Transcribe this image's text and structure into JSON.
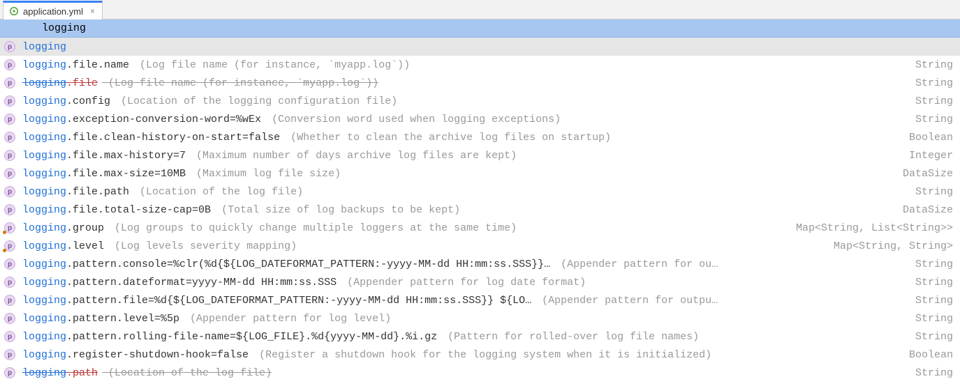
{
  "tab": {
    "label": "application.yml"
  },
  "editor": {
    "typed": "logging"
  },
  "badge_letter": "p",
  "suggestions": [
    {
      "selected": true,
      "prefix": "logging",
      "key": "",
      "desc": "",
      "type": "",
      "deprecated": false,
      "dotted": false
    },
    {
      "prefix": "logging",
      "key": ".file.name",
      "desc": " (Log file name (for instance, `myapp.log`))",
      "type": "String",
      "deprecated": false,
      "dotted": false
    },
    {
      "prefix": "logging",
      "key": ".file",
      "desc": " (Log file name (for instance, `myapp.log`))",
      "type": "String",
      "deprecated": true,
      "dotted": false
    },
    {
      "prefix": "logging",
      "key": ".config",
      "desc": " (Location of the logging configuration file)",
      "type": "String",
      "deprecated": false,
      "dotted": false
    },
    {
      "prefix": "logging",
      "key": ".exception-conversion-word=%wEx",
      "desc": " (Conversion word used when logging exceptions)",
      "type": "String",
      "deprecated": false,
      "dotted": false
    },
    {
      "prefix": "logging",
      "key": ".file.clean-history-on-start=false",
      "desc": " (Whether to clean the archive log files on startup)",
      "type": "Boolean",
      "deprecated": false,
      "dotted": false
    },
    {
      "prefix": "logging",
      "key": ".file.max-history=7",
      "desc": " (Maximum number of days archive log files are kept)",
      "type": "Integer",
      "deprecated": false,
      "dotted": false
    },
    {
      "prefix": "logging",
      "key": ".file.max-size=10MB",
      "desc": " (Maximum log file size)",
      "type": "DataSize",
      "deprecated": false,
      "dotted": false
    },
    {
      "prefix": "logging",
      "key": ".file.path",
      "desc": " (Location of the log file)",
      "type": "String",
      "deprecated": false,
      "dotted": false
    },
    {
      "prefix": "logging",
      "key": ".file.total-size-cap=0B",
      "desc": " (Total size of log backups to be kept)",
      "type": "DataSize",
      "deprecated": false,
      "dotted": false
    },
    {
      "prefix": "logging",
      "key": ".group",
      "desc": " (Log groups to quickly change multiple loggers at the same time)",
      "type": "Map<String, List<String>>",
      "deprecated": false,
      "dotted": true
    },
    {
      "prefix": "logging",
      "key": ".level",
      "desc": " (Log levels severity mapping)",
      "type": "Map<String, String>",
      "deprecated": false,
      "dotted": true
    },
    {
      "prefix": "logging",
      "key": ".pattern.console=%clr(%d{${LOG_DATEFORMAT_PATTERN:-yyyy-MM-dd HH:mm:ss.SSS}}…",
      "desc": " (Appender pattern for ou…",
      "type": "String",
      "deprecated": false,
      "dotted": false
    },
    {
      "prefix": "logging",
      "key": ".pattern.dateformat=yyyy-MM-dd HH:mm:ss.SSS",
      "desc": " (Appender pattern for log date format)",
      "type": "String",
      "deprecated": false,
      "dotted": false
    },
    {
      "prefix": "logging",
      "key": ".pattern.file=%d{${LOG_DATEFORMAT_PATTERN:-yyyy-MM-dd HH:mm:ss.SSS}} ${LO…",
      "desc": " (Appender pattern for outpu…",
      "type": "String",
      "deprecated": false,
      "dotted": false
    },
    {
      "prefix": "logging",
      "key": ".pattern.level=%5p",
      "desc": " (Appender pattern for log level)",
      "type": "String",
      "deprecated": false,
      "dotted": false
    },
    {
      "prefix": "logging",
      "key": ".pattern.rolling-file-name=${LOG_FILE}.%d{yyyy-MM-dd}.%i.gz",
      "desc": " (Pattern for rolled-over log file names)",
      "type": "String",
      "deprecated": false,
      "dotted": false
    },
    {
      "prefix": "logging",
      "key": ".register-shutdown-hook=false",
      "desc": " (Register a shutdown hook for the logging system when it is initialized)",
      "type": "Boolean",
      "deprecated": false,
      "dotted": false
    },
    {
      "prefix": "logging",
      "key": ".path",
      "desc": " (Location of the log file)",
      "type": "String",
      "deprecated": true,
      "dotted": false
    }
  ]
}
